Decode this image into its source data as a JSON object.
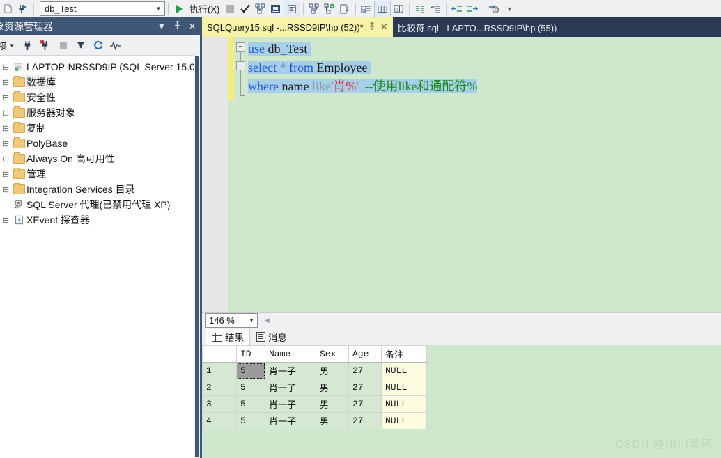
{
  "toolbar": {
    "db_value": "db_Test",
    "db_arrow": "▼",
    "execute_label": "执行(X)",
    "icons": [
      "new-query-icon",
      "connect-icon",
      "play-icon",
      "stop-icon",
      "parse-check-icon",
      "estimated-plan-icon",
      "query-options-icon",
      "results-to-text-icon",
      "include-plan-icon",
      "include-stats-icon",
      "results-to-file-icon",
      "results-to-grid-icon",
      "results-grid-alt-icon",
      "results-file-icon",
      "comment-icon",
      "uncomment-icon",
      "decrease-indent-icon",
      "increase-indent-icon",
      "specify-values-icon",
      "overflow-icon"
    ],
    "overflow_glyph": "▼"
  },
  "object_explorer": {
    "title": "象资源管理器",
    "header_buttons": [
      "▼",
      "⚲",
      "✕"
    ],
    "toolbar_icons": [
      "connect-dropdown-icon",
      "connect-icon",
      "disconnect-icon",
      "stop-icon",
      "filter-icon",
      "refresh-icon",
      "activity-monitor-icon"
    ],
    "connect_label": "接",
    "root": {
      "label": "LAPTOP-NRSSD9IP (SQL Server 15.0...",
      "icon": "server-icon",
      "expander": "⊟"
    },
    "items": [
      {
        "label": "数据库",
        "icon": "folder-icon",
        "expander": "⊞",
        "selected": true
      },
      {
        "label": "安全性",
        "icon": "folder-icon",
        "expander": "⊞",
        "selected": false
      },
      {
        "label": "服务器对象",
        "icon": "folder-icon",
        "expander": "⊞",
        "selected": false
      },
      {
        "label": "复制",
        "icon": "folder-icon",
        "expander": "⊞",
        "selected": false
      },
      {
        "label": "PolyBase",
        "icon": "folder-icon",
        "expander": "⊞",
        "selected": false
      },
      {
        "label": "Always On 高可用性",
        "icon": "folder-icon",
        "expander": "⊞",
        "selected": false
      },
      {
        "label": "管理",
        "icon": "folder-icon",
        "expander": "⊞",
        "selected": false
      },
      {
        "label": "Integration Services 目录",
        "icon": "folder-icon",
        "expander": "⊞",
        "selected": false
      },
      {
        "label": "SQL Server 代理(已禁用代理 XP)",
        "icon": "agent-disabled-icon",
        "expander": "",
        "selected": false
      },
      {
        "label": "XEvent 探查器",
        "icon": "xevent-icon",
        "expander": "⊞",
        "selected": false
      }
    ]
  },
  "editor": {
    "tabs": [
      {
        "label": "SQLQuery15.sql -...RSSD9IP\\hp (52))*",
        "active": true,
        "pin": "⚲",
        "close": "✕"
      },
      {
        "label": "比较符.sql - LAPTO...RSSD9IP\\hp (55))",
        "active": false
      }
    ],
    "fold_glyph": "−",
    "code": {
      "line1": {
        "kw": "use",
        "rest": "db_Test"
      },
      "line2": {
        "kw": "select",
        "star": "*",
        "kw2": "from",
        "table": "Employee"
      },
      "line3": {
        "kw": "where",
        "col": "name",
        "like": "like",
        "literal": "'肖%'",
        "comment": "--使用like和通配符%"
      }
    },
    "zoom_value": "146 %",
    "zoom_arrow": "▼",
    "scroll_arrow": "◀"
  },
  "results": {
    "tabs": [
      {
        "label": "结果",
        "icon": "grid-icon",
        "active": true
      },
      {
        "label": "消息",
        "icon": "message-icon",
        "active": false
      }
    ],
    "columns": [
      "ID",
      "Name",
      "Sex",
      "Age",
      "备注"
    ],
    "rows": [
      {
        "n": "1",
        "ID": "5",
        "Name": "肖一子",
        "Sex": "男",
        "Age": "27",
        "备注": "NULL"
      },
      {
        "n": "2",
        "ID": "5",
        "Name": "肖一子",
        "Sex": "男",
        "Age": "27",
        "备注": "NULL"
      },
      {
        "n": "3",
        "ID": "5",
        "Name": "肖一子",
        "Sex": "男",
        "Age": "27",
        "备注": "NULL"
      },
      {
        "n": "4",
        "ID": "5",
        "Name": "肖一子",
        "Sex": "男",
        "Age": "27",
        "备注": "NULL"
      }
    ],
    "selected_cell": {
      "row": 0,
      "column": "ID"
    }
  },
  "watermark": "CSDN @川川菜鸟",
  "colors": {
    "chrome_dark": "#2b3a52",
    "panel_header": "#3f5675",
    "editor_bg": "#cfe7cd",
    "active_tab": "#f6f2a8",
    "selection": "#a8cfe8",
    "keyword": "#1f55d6",
    "string": "#e01b1b",
    "comment": "#1a8a1a",
    "null_cell": "#fbfbdf"
  }
}
